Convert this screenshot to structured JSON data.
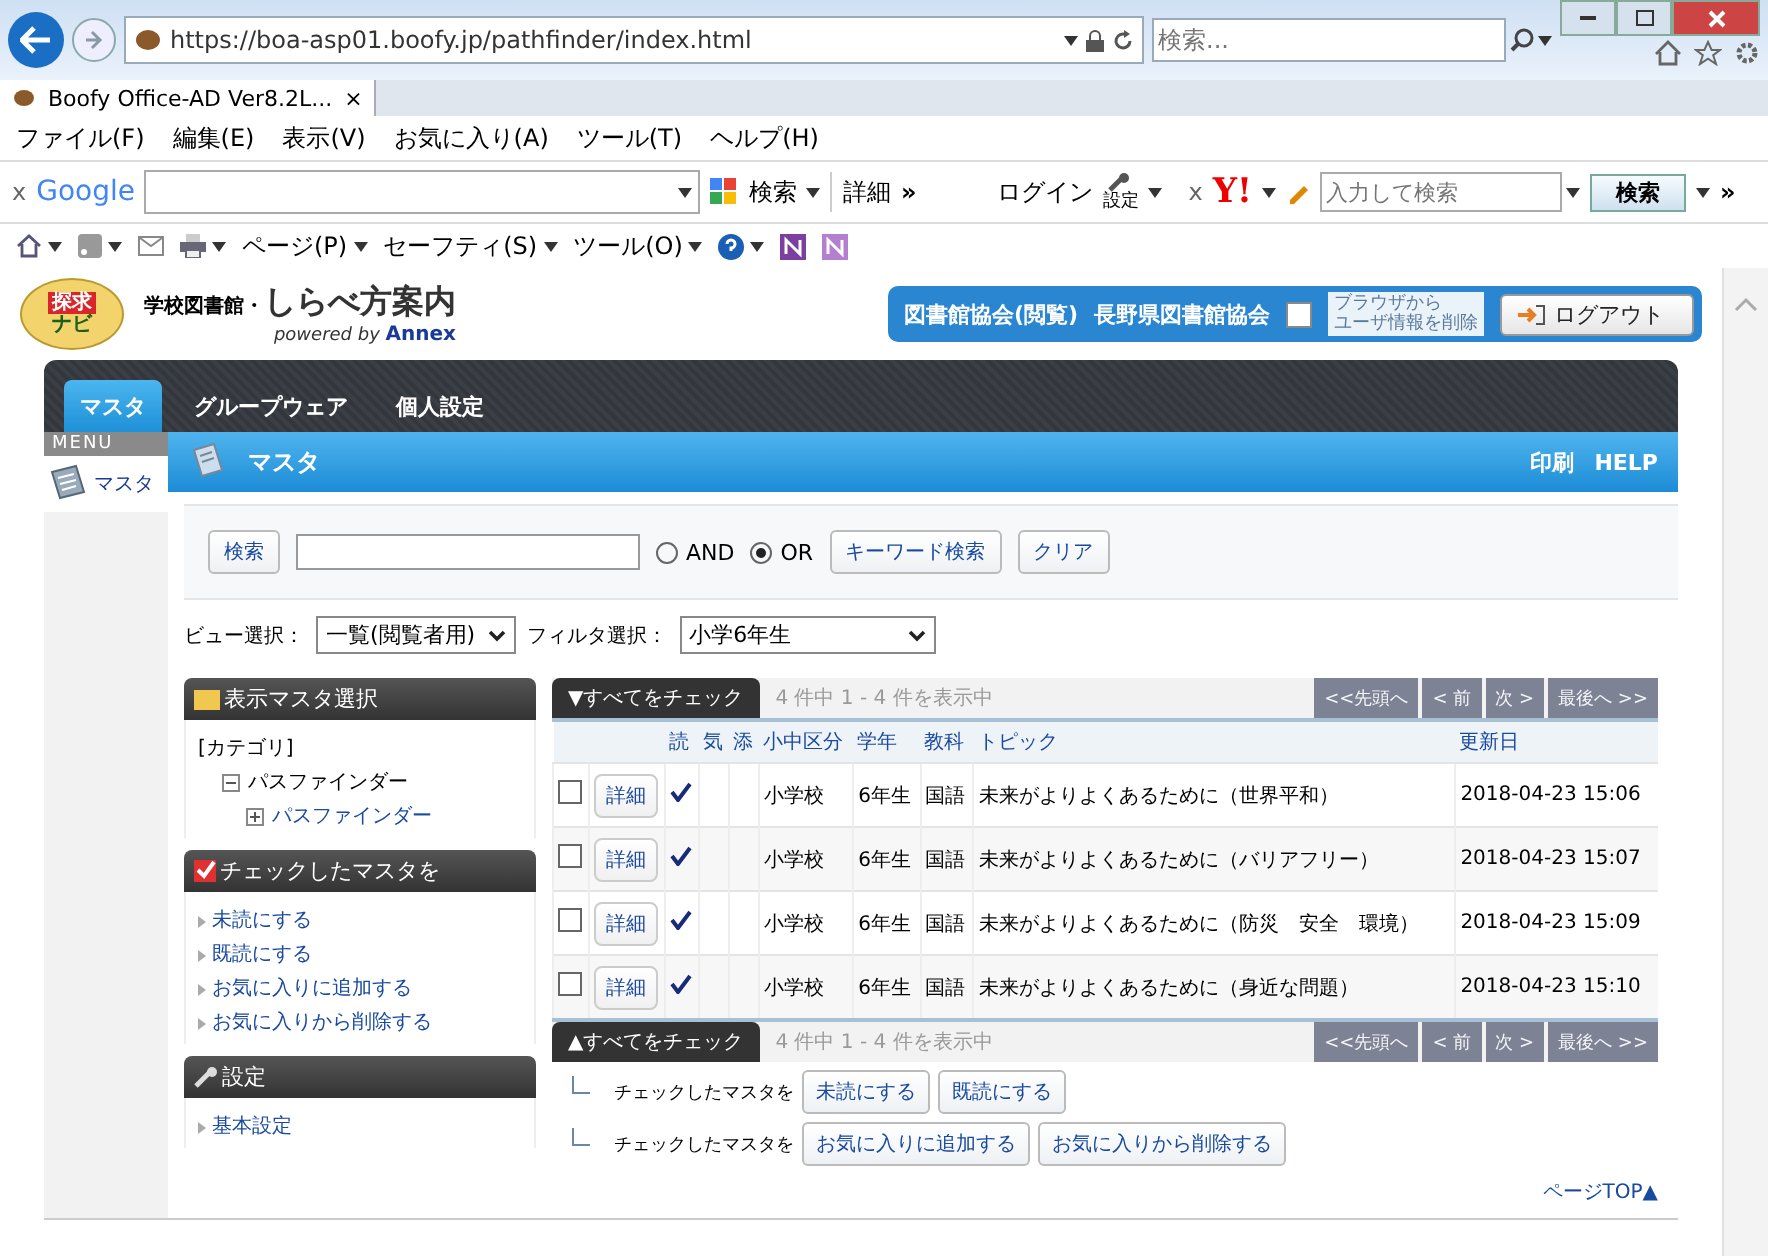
{
  "browser": {
    "url": "https://boa-asp01.boofy.jp/pathfinder/index.html",
    "search_placeholder": "検索...",
    "tab": "Boofy Office-AD Ver8.2L...",
    "tab_close": "×",
    "menu": [
      "ファイル(F)",
      "編集(E)",
      "表示(V)",
      "お気に入り(A)",
      "ツール(T)",
      "ヘルプ(H)"
    ],
    "toolbar": {
      "close": "x",
      "logo": "Google",
      "search": "検索",
      "details": "詳細",
      "more": "»",
      "login": "ログイン",
      "settings": "設定",
      "close_2": "x",
      "yahoo": "Y!",
      "placeholder": "入力して検索",
      "button": "検索",
      "more_2": "»"
    },
    "commands": [
      "ページ(P)",
      "セーフティ(S)",
      "ツール(O)"
    ]
  },
  "header": {
    "logo_top": "探求",
    "logo_bottom": "ナビ",
    "title_small": "学校図書館・",
    "title": "しらべ方案内",
    "powered": "powered by **Annex**",
    "group": "図書館協会(閲覧)",
    "org": "長野県図書館協会",
    "clear_checked": false,
    "clear_note": [
      "ブラウザから",
      "ユーザ情報を削除"
    ],
    "logout": "ログアウト"
  },
  "nav_tabs": [
    {
      "label": "マスタ",
      "selected": true
    },
    {
      "label": "グループウェア",
      "selected": false
    },
    {
      "label": "個人設定",
      "selected": false
    }
  ],
  "side_menu": {
    "title": "MENU",
    "items": [
      {
        "label": "マスタ"
      }
    ]
  },
  "banner": {
    "title": "マスタ",
    "links": [
      "印刷",
      "HELP"
    ]
  },
  "search": {
    "button": "検索",
    "options": [
      {
        "label": "AND",
        "selected": false
      },
      {
        "label": "OR",
        "selected": true
      }
    ],
    "buttons": [
      "キーワード検索",
      "クリア"
    ]
  },
  "filters": [
    {
      "label": "ビュー選択：",
      "value": "一覧(閲覧者用)"
    },
    {
      "label": "フィルタ選択：",
      "value": "小学6年生"
    }
  ],
  "panels": [
    {
      "title": "表示マスタ選択",
      "kind": "tree",
      "heading": "[カテゴリ]",
      "tree": [
        {
          "label": "パスファインダー",
          "expanded": true,
          "children": [
            {
              "label": "パスファインダー",
              "expanded": false
            }
          ]
        }
      ]
    },
    {
      "title": "チェックしたマスタを",
      "kind": "links",
      "items": [
        "未読にする",
        "既読にする",
        "お気に入りに追加する",
        "お気に入りから削除する"
      ]
    },
    {
      "title": "設定",
      "kind": "links",
      "items": [
        "基本設定"
      ]
    }
  ],
  "list": {
    "check_all_top": "▼すべてをチェック",
    "count_top": "4 件中 1 - 4 件を表示中",
    "pager_top": [
      {
        "label": "<<先頭へ",
        "disabled": true
      },
      {
        "label": "< 前",
        "disabled": true
      },
      {
        "label": "次 >",
        "disabled": true
      },
      {
        "label": "最後へ >>",
        "disabled": true
      }
    ],
    "columns": [
      "読",
      "気",
      "添",
      "小中区分",
      "学年",
      "教科",
      "トピック",
      "更新日"
    ],
    "rows": [
      {
        "checked": false,
        "detail": "詳細",
        "read": true,
        "school": "小学校",
        "grade": "6年生",
        "subject": "国語",
        "topic": "未来がよりよくあるために（世界平和）",
        "updated": "2018-04-23 15:06"
      },
      {
        "checked": false,
        "detail": "詳細",
        "read": true,
        "school": "小学校",
        "grade": "6年生",
        "subject": "国語",
        "topic": "未来がよりよくあるために（バリアフリー）",
        "updated": "2018-04-23 15:07"
      },
      {
        "checked": false,
        "detail": "詳細",
        "read": true,
        "school": "小学校",
        "grade": "6年生",
        "subject": "国語",
        "topic": "未来がよりよくあるために（防災　安全　環境）",
        "updated": "2018-04-23 15:09"
      },
      {
        "checked": false,
        "detail": "詳細",
        "read": true,
        "school": "小学校",
        "grade": "6年生",
        "subject": "国語",
        "topic": "未来がよりよくあるために（身近な問題）",
        "updated": "2018-04-23 15:10"
      }
    ],
    "check_all_bottom": "▲すべてをチェック",
    "count_bottom": "4 件中 1 - 4 件を表示中",
    "pager_bottom": [
      {
        "label": "<<先頭へ",
        "disabled": true
      },
      {
        "label": "< 前",
        "disabled": true
      },
      {
        "label": "次 >",
        "disabled": true
      },
      {
        "label": "最後へ >>",
        "disabled": true
      }
    ],
    "actions": [
      {
        "label": "チェックしたマスタを",
        "buttons": [
          "未読にする",
          "既読にする"
        ]
      },
      {
        "label": "チェックしたマスタを",
        "buttons": [
          "お気に入りに追加する",
          "お気に入りから削除する"
        ]
      }
    ],
    "page_top": "ページTOP▲"
  }
}
